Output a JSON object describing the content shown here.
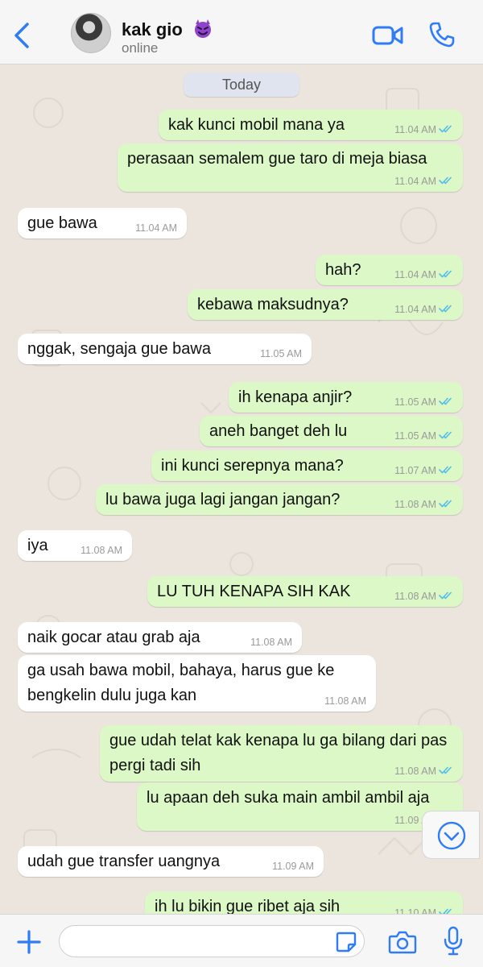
{
  "header": {
    "contact_name": "kak gio",
    "status": "online"
  },
  "chat": {
    "date_chip": "Today",
    "messages": [
      {
        "dir": "out",
        "text": "kak kunci mobil mana ya",
        "time": "11.04 AM"
      },
      {
        "dir": "out",
        "text": "perasaan semalem gue taro di meja biasa",
        "time": "11.04 AM"
      },
      {
        "dir": "in",
        "text": "gue bawa",
        "time": "11.04 AM"
      },
      {
        "dir": "out",
        "text": "hah?",
        "time": "11.04 AM"
      },
      {
        "dir": "out",
        "text": "kebawa maksudnya?",
        "time": "11.04 AM"
      },
      {
        "dir": "in",
        "text": "nggak, sengaja gue bawa",
        "time": "11.05 AM"
      },
      {
        "dir": "out",
        "text": "ih kenapa anjir?",
        "time": "11.05 AM"
      },
      {
        "dir": "out",
        "text": "aneh banget deh lu",
        "time": "11.05 AM"
      },
      {
        "dir": "out",
        "text": "ini kunci serepnya mana?",
        "time": "11.07 AM"
      },
      {
        "dir": "out",
        "text": "lu bawa juga lagi jangan jangan?",
        "time": "11.08 AM"
      },
      {
        "dir": "in",
        "text": "iya",
        "time": "11.08 AM"
      },
      {
        "dir": "out",
        "text": "LU TUH KENAPA SIH KAK",
        "time": "11.08 AM"
      },
      {
        "dir": "in",
        "text": "naik gocar atau grab aja",
        "time": "11.08 AM"
      },
      {
        "dir": "in",
        "text": "ga usah bawa mobil, bahaya, harus gue ke bengkelin dulu juga kan",
        "time": "11.08 AM"
      },
      {
        "dir": "out",
        "text": "gue udah telat kak kenapa lu ga bilang dari pas pergi tadi sih",
        "time": "11.08 AM"
      },
      {
        "dir": "out",
        "text": "lu apaan deh suka main ambil ambil aja",
        "time": "11.09 AM"
      },
      {
        "dir": "in",
        "text": "udah gue transfer uangnya",
        "time": "11.09 AM"
      },
      {
        "dir": "out",
        "text": "ih lu bikin gue ribet aja sih",
        "time": "11.10 AM"
      }
    ]
  },
  "composer": {
    "input_value": "",
    "input_placeholder": ""
  },
  "colors": {
    "accent": "#2f7cf6",
    "outgoing_bubble": "#dcf8c6",
    "incoming_bubble": "#ffffff",
    "read_ticks": "#53bdeb"
  },
  "icons": [
    "back-chevron-icon",
    "devil-emoji-icon",
    "video-call-icon",
    "phone-icon",
    "chevron-down-icon",
    "plus-icon",
    "sticker-icon",
    "camera-icon",
    "microphone-icon",
    "double-check-icon"
  ]
}
